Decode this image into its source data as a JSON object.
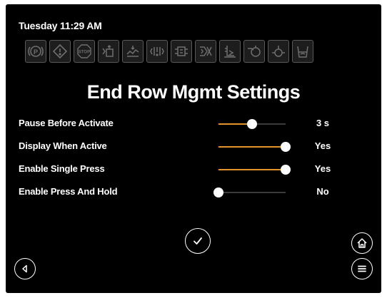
{
  "status": {
    "datetime": "Tuesday 11:29 AM"
  },
  "status_icons": [
    {
      "name": "parking-brake-icon"
    },
    {
      "name": "warning-icon"
    },
    {
      "name": "stop-icon",
      "text": "STOP"
    },
    {
      "name": "hitch-icon"
    },
    {
      "name": "steering-terrain-icon"
    },
    {
      "name": "engine-fault-icon"
    },
    {
      "name": "transmission-icon"
    },
    {
      "name": "filter-restriction-icon"
    },
    {
      "name": "fluid-level-icon"
    },
    {
      "name": "hydraulic-icon"
    },
    {
      "name": "temperature-icon"
    },
    {
      "name": "fuel-icon"
    }
  ],
  "page": {
    "title": "End Row Mgmt Settings"
  },
  "settings": [
    {
      "label": "Pause Before Activate",
      "value": "3 s",
      "level": 0.5
    },
    {
      "label": "Display When Active",
      "value": "Yes",
      "level": 1.0
    },
    {
      "label": "Enable Single Press",
      "value": "Yes",
      "level": 1.0
    },
    {
      "label": "Enable Press And Hold",
      "value": "No",
      "level": 0.0
    }
  ],
  "colors": {
    "background": "#000000",
    "slider_fill": "#e5942b",
    "slider_track": "#3a3a3a",
    "text": "#ffffff",
    "icon": "#6e6e6e"
  },
  "buttons": {
    "confirm_icon": "checkmark-icon",
    "home_icon": "home-icon",
    "back_icon": "back-arrow-icon",
    "menu_icon": "menu-icon"
  }
}
